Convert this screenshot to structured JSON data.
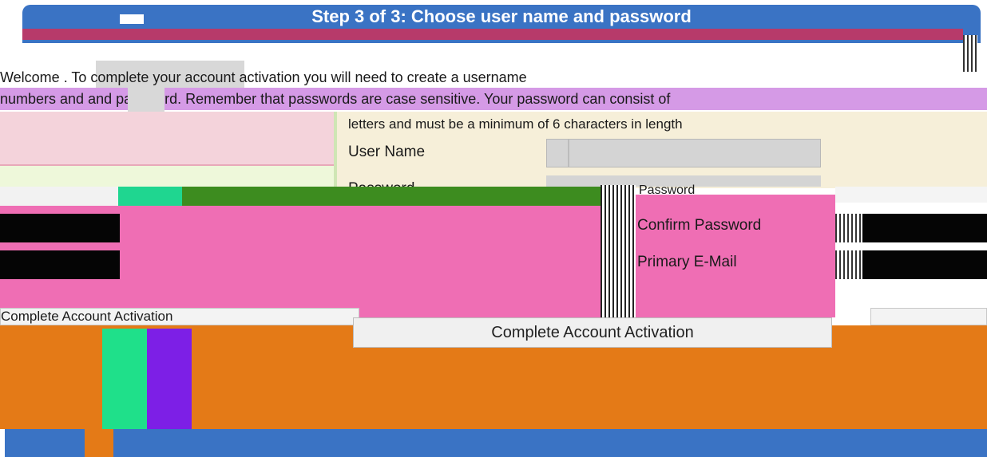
{
  "header": {
    "title": "Step 3 of 3: Choose user name and password"
  },
  "intro": {
    "line1": "Welcome                     . To complete your account activation you will need to create a username",
    "line2": "numbers and        and password. Remember that passwords are case sensitive. Your password can consist of",
    "line3": "letters and must be a minimum of 6 characters in length"
  },
  "form": {
    "username_label": "User Name",
    "password_label": "Password",
    "password_label_small": "Password",
    "confirm_password_label": "Confirm Password",
    "email_label": "Primary E-Mail"
  },
  "actions": {
    "complete_button_label": "Complete Account Activation",
    "ghost_button_label": "Complete Account Activation"
  },
  "colors": {
    "header_blue": "#3a73c4",
    "magenta": "#ef6eb4",
    "orange": "#e47a17",
    "green": "#3d8c1f",
    "teal": "#1fd690",
    "violet": "#7d1fe6"
  }
}
